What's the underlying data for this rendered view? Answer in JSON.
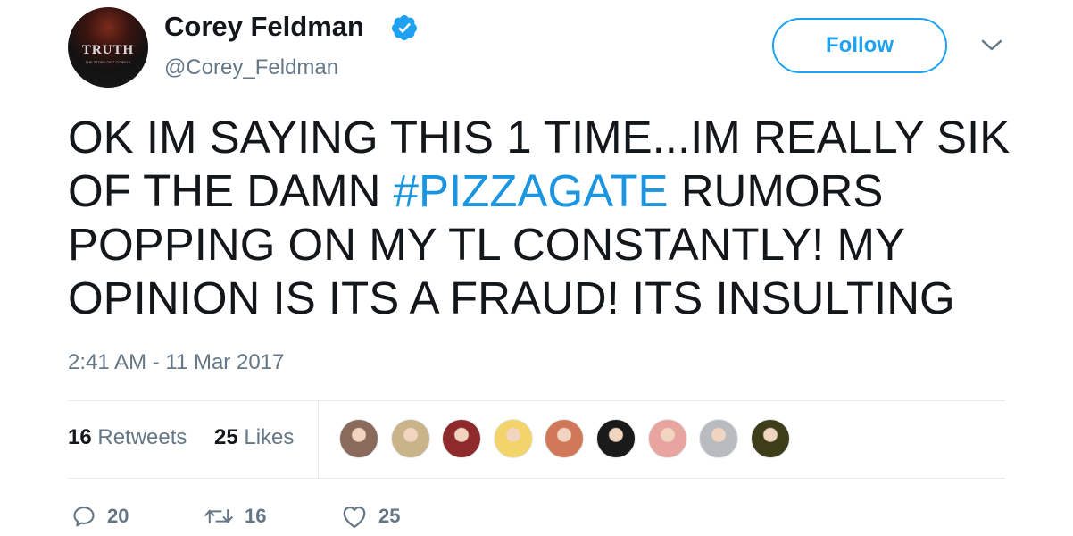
{
  "header": {
    "display_name": "Corey Feldman",
    "handle": "@Corey_Feldman",
    "follow_label": "Follow",
    "avatar_text": "TRUTH",
    "avatar_subtext": "THE STORY OF 2 COREYS",
    "verified_color": "#1da1f2"
  },
  "tweet": {
    "text_before": "OK IM SAYING THIS 1 TIME...IM REALLY SIK OF THE DAMN ",
    "hashtag": "#PIZZAGATE",
    "text_after": " RUMORS POPPING ON MY TL CONSTANTLY! MY OPINION IS ITS A FRAUD! ITS INSULTING",
    "timestamp": "2:41 AM - 11 Mar 2017"
  },
  "stats": {
    "retweets_count": "16",
    "retweets_label": "Retweets",
    "likes_count": "25",
    "likes_label": "Likes"
  },
  "likers": [
    {
      "name": "liker-1",
      "color": "#8a6a5a"
    },
    {
      "name": "liker-2",
      "color": "#c9b48a"
    },
    {
      "name": "liker-3",
      "color": "#8e2a2a"
    },
    {
      "name": "liker-4",
      "color": "#f2d46a"
    },
    {
      "name": "liker-5",
      "color": "#d2785a"
    },
    {
      "name": "liker-6",
      "color": "#1a1a1a"
    },
    {
      "name": "liker-7",
      "color": "#e8a5a0"
    },
    {
      "name": "liker-8",
      "color": "#b8bcc0"
    },
    {
      "name": "liker-9",
      "color": "#3d3d1a"
    }
  ],
  "actions": {
    "reply_count": "20",
    "retweet_count": "16",
    "like_count": "25"
  },
  "colors": {
    "accent": "#1da1f2",
    "hashtag": "#1b95e0",
    "muted": "#657786"
  }
}
